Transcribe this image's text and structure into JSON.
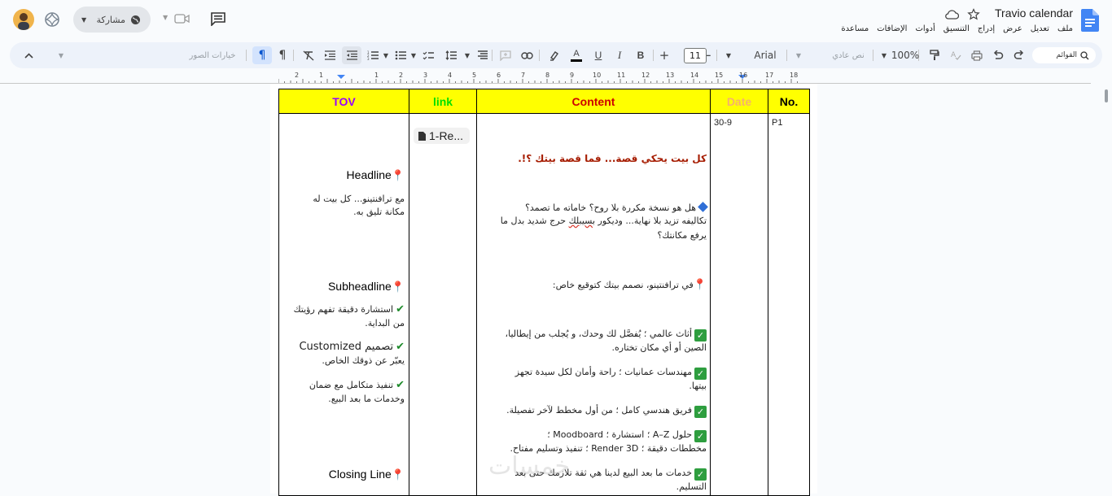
{
  "header": {
    "doc_title": "Travio calendar",
    "menus": [
      "ملف",
      "تعديل",
      "عرض",
      "إدراج",
      "التنسيق",
      "أدوات",
      "الإضافات",
      "مساعدة"
    ],
    "share_label": "مشاركة"
  },
  "toolbar": {
    "menus_search": "القوائم",
    "zoom": "100%",
    "style": "نص عادي",
    "font": "Arial",
    "font_size": "11",
    "image_options": "خيارات الصور"
  },
  "ruler": {
    "numbers": [
      "18",
      "17",
      "16",
      "15",
      "14",
      "13",
      "12",
      "11",
      "10",
      "9",
      "8",
      "7",
      "6",
      "5",
      "4",
      "3",
      "2",
      "1",
      "1",
      "2"
    ]
  },
  "table": {
    "headers": {
      "no": "No.",
      "date": "Date",
      "content": "Content",
      "link": "link",
      "tov": "TOV"
    },
    "header_colors": {
      "no": "#000000",
      "date": "#f6b26b",
      "content": "#cc0000",
      "link": "#00e000",
      "tov": "#9900ff"
    },
    "row": {
      "no": "P1",
      "date": "30-9",
      "link_chip": "1-Re...",
      "content": {
        "title": "كل بيت يحكي قصة... فما قصة بيتك ؟!.",
        "q1": "هل هو نسخة مكررة بلا روح؟ خاماته ما تصمد؟",
        "q2_a": "تكاليفه تزيد بلا نهاية... وديكور ",
        "q2_spell": "بسيبلك",
        "q2_b": " حرج شديد بدل ما",
        "q3": "يرفع مكانتك؟",
        "intro": "في ترافنتينو، نصمم بيتك كتوقيع خاص:",
        "p1_l1": "أثاث عالمي ؛ يُفصَّل لك وحدك، و يُجلب من إيطاليا،",
        "p1_l2": "الصين أو أي مكان تختاره.",
        "p2_l1": "مهندسات عمانيات ؛ راحة وأمان لكل سيدة تجهز",
        "p2_l2": "بيتها.",
        "p3": "فريق هندسي كامل ؛ من أول مخطط لآخر تفصيلة.",
        "p4_l1": "حلول A–Z ؛ استشارة ؛ Moodboard ؛",
        "p4_l2": "مخططات دقيقة ؛ Render 3D ؛ تنفيذ وتسليم مفتاح.",
        "p5_l1": "خدمات ما بعد البيع لدينا هي ثقة تلازمك حتى بعد",
        "p5_l2": "التسليم."
      },
      "tov": {
        "headline": "Headline",
        "headline_l1": "مع ترافنتينو... كل بيت له",
        "headline_l2": "مكانة تليق به.",
        "subheadline": "Subheadline",
        "s1_l1": "استشارة دقيقة تفهم رؤيتك",
        "s1_l2": "من البداية.",
        "s2_l1": "تصميم Customized",
        "s2_l2": "يعبّر عن ذوقك الخاص.",
        "s3_l1": "تنفيذ متكامل مع ضمان",
        "s3_l2": "وخدمات ما بعد البيع.",
        "closing": "Closing Line"
      }
    }
  },
  "watermark": "خمسات"
}
